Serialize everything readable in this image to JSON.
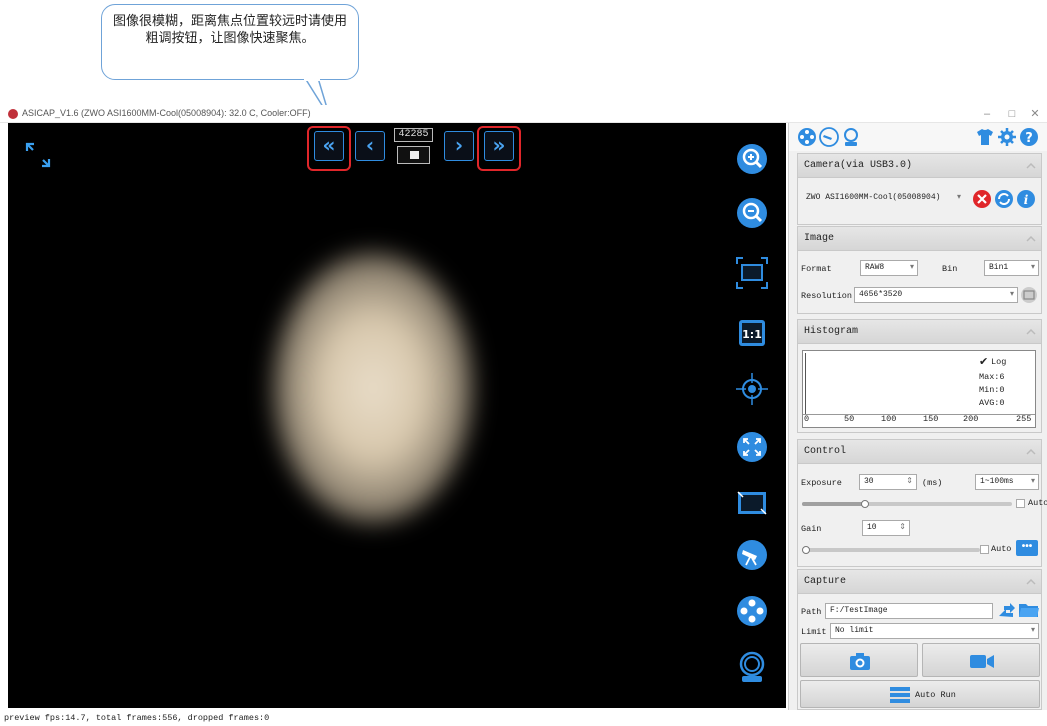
{
  "callout": {
    "text": "图像很模糊，距离焦点位置较远时请使用粗调按钮，让图像快速聚焦。"
  },
  "window": {
    "title": "ASICAP_V1.6 (ZWO ASI1600MM-Cool(05008904): 32.0 C, Cooler:OFF)",
    "minimize": "–",
    "maximize": "□",
    "close": "✕"
  },
  "preview": {
    "coarse_back": "«",
    "fine_back": "‹",
    "counter": "42285",
    "fine_forward": "›",
    "coarse_forward": "»"
  },
  "status": {
    "text": "preview fps:14.7, total frames:556, dropped frames:0"
  },
  "camera": {
    "title": "Camera(via USB3.0)",
    "selected": "ZWO ASI1600MM-Cool(05008904)"
  },
  "image": {
    "title": "Image",
    "format_label": "Format",
    "format_value": "RAW8",
    "bin_label": "Bin",
    "bin_value": "Bin1",
    "resolution_label": "Resolution",
    "resolution_value": "4656*3520"
  },
  "histogram": {
    "title": "Histogram",
    "log_label": "Log",
    "log_checked": true,
    "max": "Max:6",
    "min": "Min:0",
    "avg": "AVG:0",
    "ticks": [
      "0",
      "50",
      "100",
      "150",
      "200",
      "255"
    ]
  },
  "control": {
    "title": "Control",
    "exposure_label": "Exposure",
    "exposure_value": "30",
    "exposure_unit": "(ms)",
    "exposure_range": "1~100ms",
    "exposure_slider": 0.3,
    "exposure_auto": "Auto",
    "gain_label": "Gain",
    "gain_value": "10",
    "gain_slider": 0.0,
    "gain_auto": "Auto",
    "more": "•••"
  },
  "capture": {
    "title": "Capture",
    "path_label": "Path",
    "path_value": "F:/TestImage",
    "limit_label": "Limit",
    "limit_value": "No limit",
    "auto_run": "Auto Run"
  },
  "colors": {
    "accent": "#2f8ce0",
    "highlight": "#e0262a"
  }
}
